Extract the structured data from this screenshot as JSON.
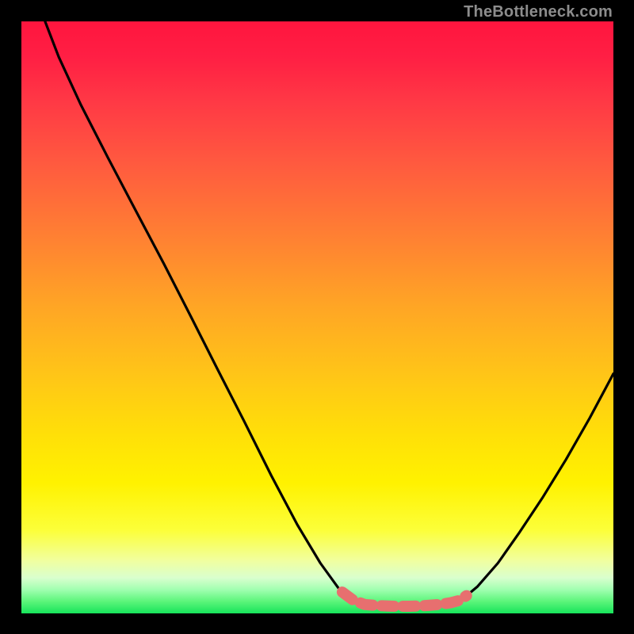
{
  "watermark": "TheBottleneck.com",
  "colors": {
    "background_page": "#000000",
    "curve_stroke": "#000000",
    "highlight_stroke": "#e76f6f",
    "watermark_text": "#8c8c8c"
  },
  "chart_data": {
    "type": "line",
    "title": "",
    "xlabel": "",
    "ylabel": "",
    "xlim": [
      0,
      100
    ],
    "ylim": [
      0,
      100
    ],
    "grid": false,
    "legend": false,
    "series": [
      {
        "name": "left-curve",
        "x": [
          4.0,
          6.3,
          10.0,
          14.6,
          19.6,
          24.1,
          28.7,
          33.0,
          37.6,
          42.2,
          46.6,
          50.5,
          53.6,
          55.6,
          57.0
        ],
        "y": [
          100.0,
          94.0,
          86.0,
          77.0,
          67.5,
          59.0,
          50.0,
          41.5,
          32.5,
          23.3,
          15.0,
          8.5,
          4.2,
          2.4,
          1.7
        ]
      },
      {
        "name": "trough",
        "x": [
          57.0,
          60.0,
          63.0,
          66.0,
          69.0,
          72.0,
          74.0
        ],
        "y": [
          1.7,
          1.4,
          1.2,
          1.2,
          1.3,
          1.6,
          2.0
        ]
      },
      {
        "name": "right-curve",
        "x": [
          74.0,
          77.0,
          80.5,
          84.0,
          88.0,
          92.0,
          96.0,
          100.0
        ],
        "y": [
          2.0,
          4.5,
          8.5,
          13.5,
          19.5,
          26.0,
          33.0,
          40.5
        ]
      },
      {
        "name": "highlight-segment",
        "x": [
          54.2,
          56.1,
          58.0,
          60.5,
          63.0,
          65.5,
          68.0,
          70.5,
          72.5,
          74.0,
          75.2
        ],
        "y": [
          3.6,
          2.2,
          1.5,
          1.3,
          1.2,
          1.2,
          1.3,
          1.5,
          1.8,
          2.2,
          3.0
        ]
      }
    ]
  }
}
